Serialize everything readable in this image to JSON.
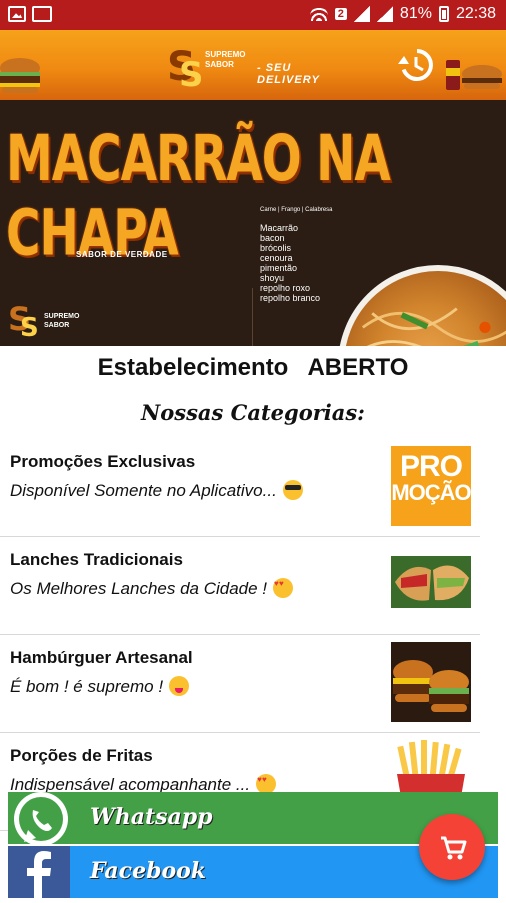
{
  "status_bar": {
    "badge": "2",
    "battery": "81%",
    "time": "22:38"
  },
  "header": {
    "logo_line1": "SUPREMO",
    "logo_line2": "SABOR",
    "tagline": "- SEU DELIVERY",
    "history_icon": "history-icon"
  },
  "banner": {
    "title": "MACARRÃO NA CHAPA",
    "slogan": "SABOR DE VERDADE",
    "menu_heading": "Carne | Frango | Calabresa",
    "menu_items": [
      "Macarrão",
      "bacon",
      "brócolis",
      "cenoura",
      "pimentão",
      "shoyu",
      "repolho roxo",
      "repolho branco"
    ],
    "logo_line1": "SUPREMO",
    "logo_line2": "SABOR"
  },
  "main": {
    "status_label": "Estabelecimento",
    "status_value": "ABERTO",
    "categories_title": "Nossas Categorias:"
  },
  "categories": [
    {
      "name": "Promoções Exclusivas",
      "description": "Disponível Somente no Aplicativo...",
      "emoji": "sunglasses-emoji",
      "thumb_text1": "PRO",
      "thumb_text2": "MOÇÃO"
    },
    {
      "name": "Lanches Tradicionais",
      "description": "Os Melhores Lanches da Cidade !",
      "emoji": "heart-eyes-emoji"
    },
    {
      "name": "Hambúrguer Artesanal",
      "description": "É bom !  é supremo !",
      "emoji": "yum-emoji"
    },
    {
      "name": "Porções de Fritas",
      "description": "Indispensável acompanhante ...",
      "emoji": "heart-eyes-emoji"
    }
  ],
  "social": {
    "whatsapp_label": "Whatsapp",
    "facebook_label": "Facebook"
  },
  "fab": {
    "icon": "cart-icon"
  },
  "colors": {
    "status_bar": "#b71c1c",
    "header_orange": "#f08a12",
    "whatsapp_green": "#43a047",
    "facebook_blue": "#2196f3",
    "fab_red": "#f44336"
  }
}
